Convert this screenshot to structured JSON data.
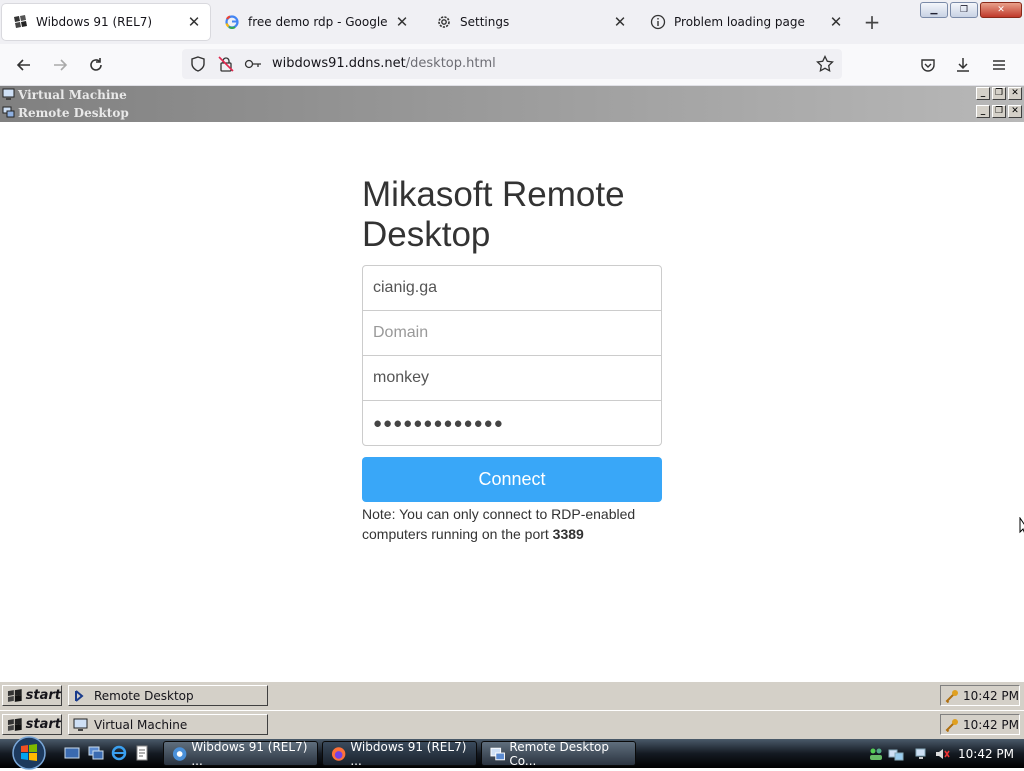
{
  "browser": {
    "tabs": [
      {
        "title": "Wibdows 91 (REL7)",
        "icon": "wibdows-logo-icon",
        "active": true
      },
      {
        "title": "free demo rdp - Google Search",
        "icon": "google-g-icon",
        "active": false
      },
      {
        "title": "Settings",
        "icon": "gear-icon",
        "active": false
      },
      {
        "title": "Problem loading page",
        "icon": "info-icon",
        "active": false
      }
    ],
    "window_controls": [
      "minimize",
      "restore",
      "close"
    ],
    "url_host": "wibdows91.ddns.net",
    "url_path": "/desktop.html"
  },
  "vm_windows": [
    {
      "title": "Virtual Machine",
      "icon": "monitor-icon"
    },
    {
      "title": "Remote Desktop",
      "icon": "remote-desktop-icon"
    }
  ],
  "login": {
    "title": "Mikasoft Remote Desktop",
    "host_value": "cianig.ga",
    "domain_placeholder": "Domain",
    "username_value": "monkey",
    "password_mask": "●●●●●●●●●●●●●",
    "connect_label": "Connect",
    "note_prefix": "Note: You can only connect to RDP-enabled computers running on the port",
    "note_port": "3389"
  },
  "inner_taskbars": [
    {
      "start_label": "start",
      "task_label": "Remote Desktop",
      "clock": "10:42 PM"
    },
    {
      "start_label": "start",
      "task_label": "Virtual Machine",
      "clock": "10:42 PM"
    }
  ],
  "vista_taskbar": {
    "tasks": [
      {
        "label": "Wibdows 91 (REL7) ...",
        "icon": "chrome-icon"
      },
      {
        "label": "Wibdows 91 (REL7) ...",
        "icon": "firefox-icon"
      },
      {
        "label": "Remote Desktop Co...",
        "icon": "remote-desktop-icon"
      }
    ],
    "clock": "10:42 PM"
  }
}
